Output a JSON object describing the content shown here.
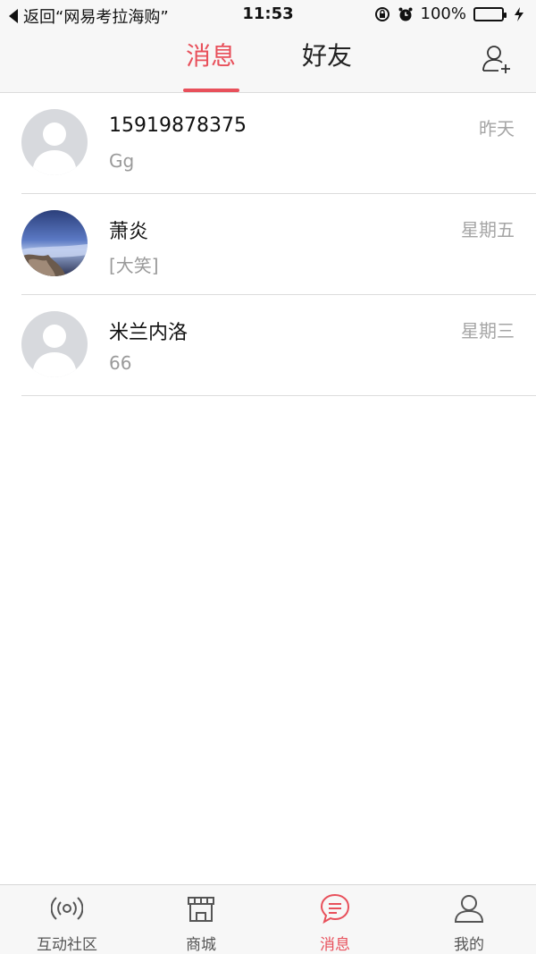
{
  "status_bar": {
    "back_text": "返回“网易考拉海购”",
    "time": "11:53",
    "battery": "100%"
  },
  "header": {
    "tabs": [
      {
        "label": "消息",
        "active": true
      },
      {
        "label": "好友",
        "active": false
      }
    ],
    "add_friend_icon": "add-user-icon"
  },
  "messages": [
    {
      "name": "15919878375",
      "preview": "Gg",
      "time": "昨天",
      "avatar": "default"
    },
    {
      "name": "萧炎",
      "preview": "[大笑]",
      "time": "星期五",
      "avatar": "photo"
    },
    {
      "name": "米兰内洛",
      "preview": "66",
      "time": "星期三",
      "avatar": "default"
    }
  ],
  "tabbar": [
    {
      "label": "互动社区",
      "icon": "broadcast-icon",
      "active": false
    },
    {
      "label": "商城",
      "icon": "shop-icon",
      "active": false
    },
    {
      "label": "消息",
      "icon": "chat-icon",
      "active": true
    },
    {
      "label": "我的",
      "icon": "user-icon",
      "active": false
    }
  ],
  "colors": {
    "accent": "#e8505b",
    "battery": "#4cd964"
  }
}
